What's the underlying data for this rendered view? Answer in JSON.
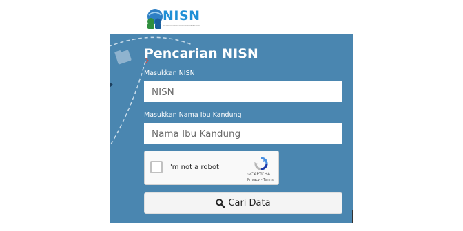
{
  "logo": {
    "text": "NISN",
    "tagline": "KEMENTERIAN PENDIDIKAN NASIONAL"
  },
  "form": {
    "title": "Pencarian NISN",
    "nisn_label": "Masukkan NISN",
    "nisn_placeholder": "NISN",
    "mother_label": "Masukkan Nama Ibu Kandung",
    "mother_placeholder": "Nama Ibu Kandung",
    "submit_label": "Cari Data"
  },
  "recaptcha": {
    "checkbox_label": "I'm not a robot",
    "brand": "reCAPTCHA",
    "links": "Privacy - Terms"
  },
  "colors": {
    "panel_bg": "#4a86b0",
    "logo_blue": "#1f8fd6"
  },
  "icons": {
    "search": "search-icon",
    "recaptcha": "recaptcha-logo-icon",
    "logo": "nisn-logo-icon"
  }
}
